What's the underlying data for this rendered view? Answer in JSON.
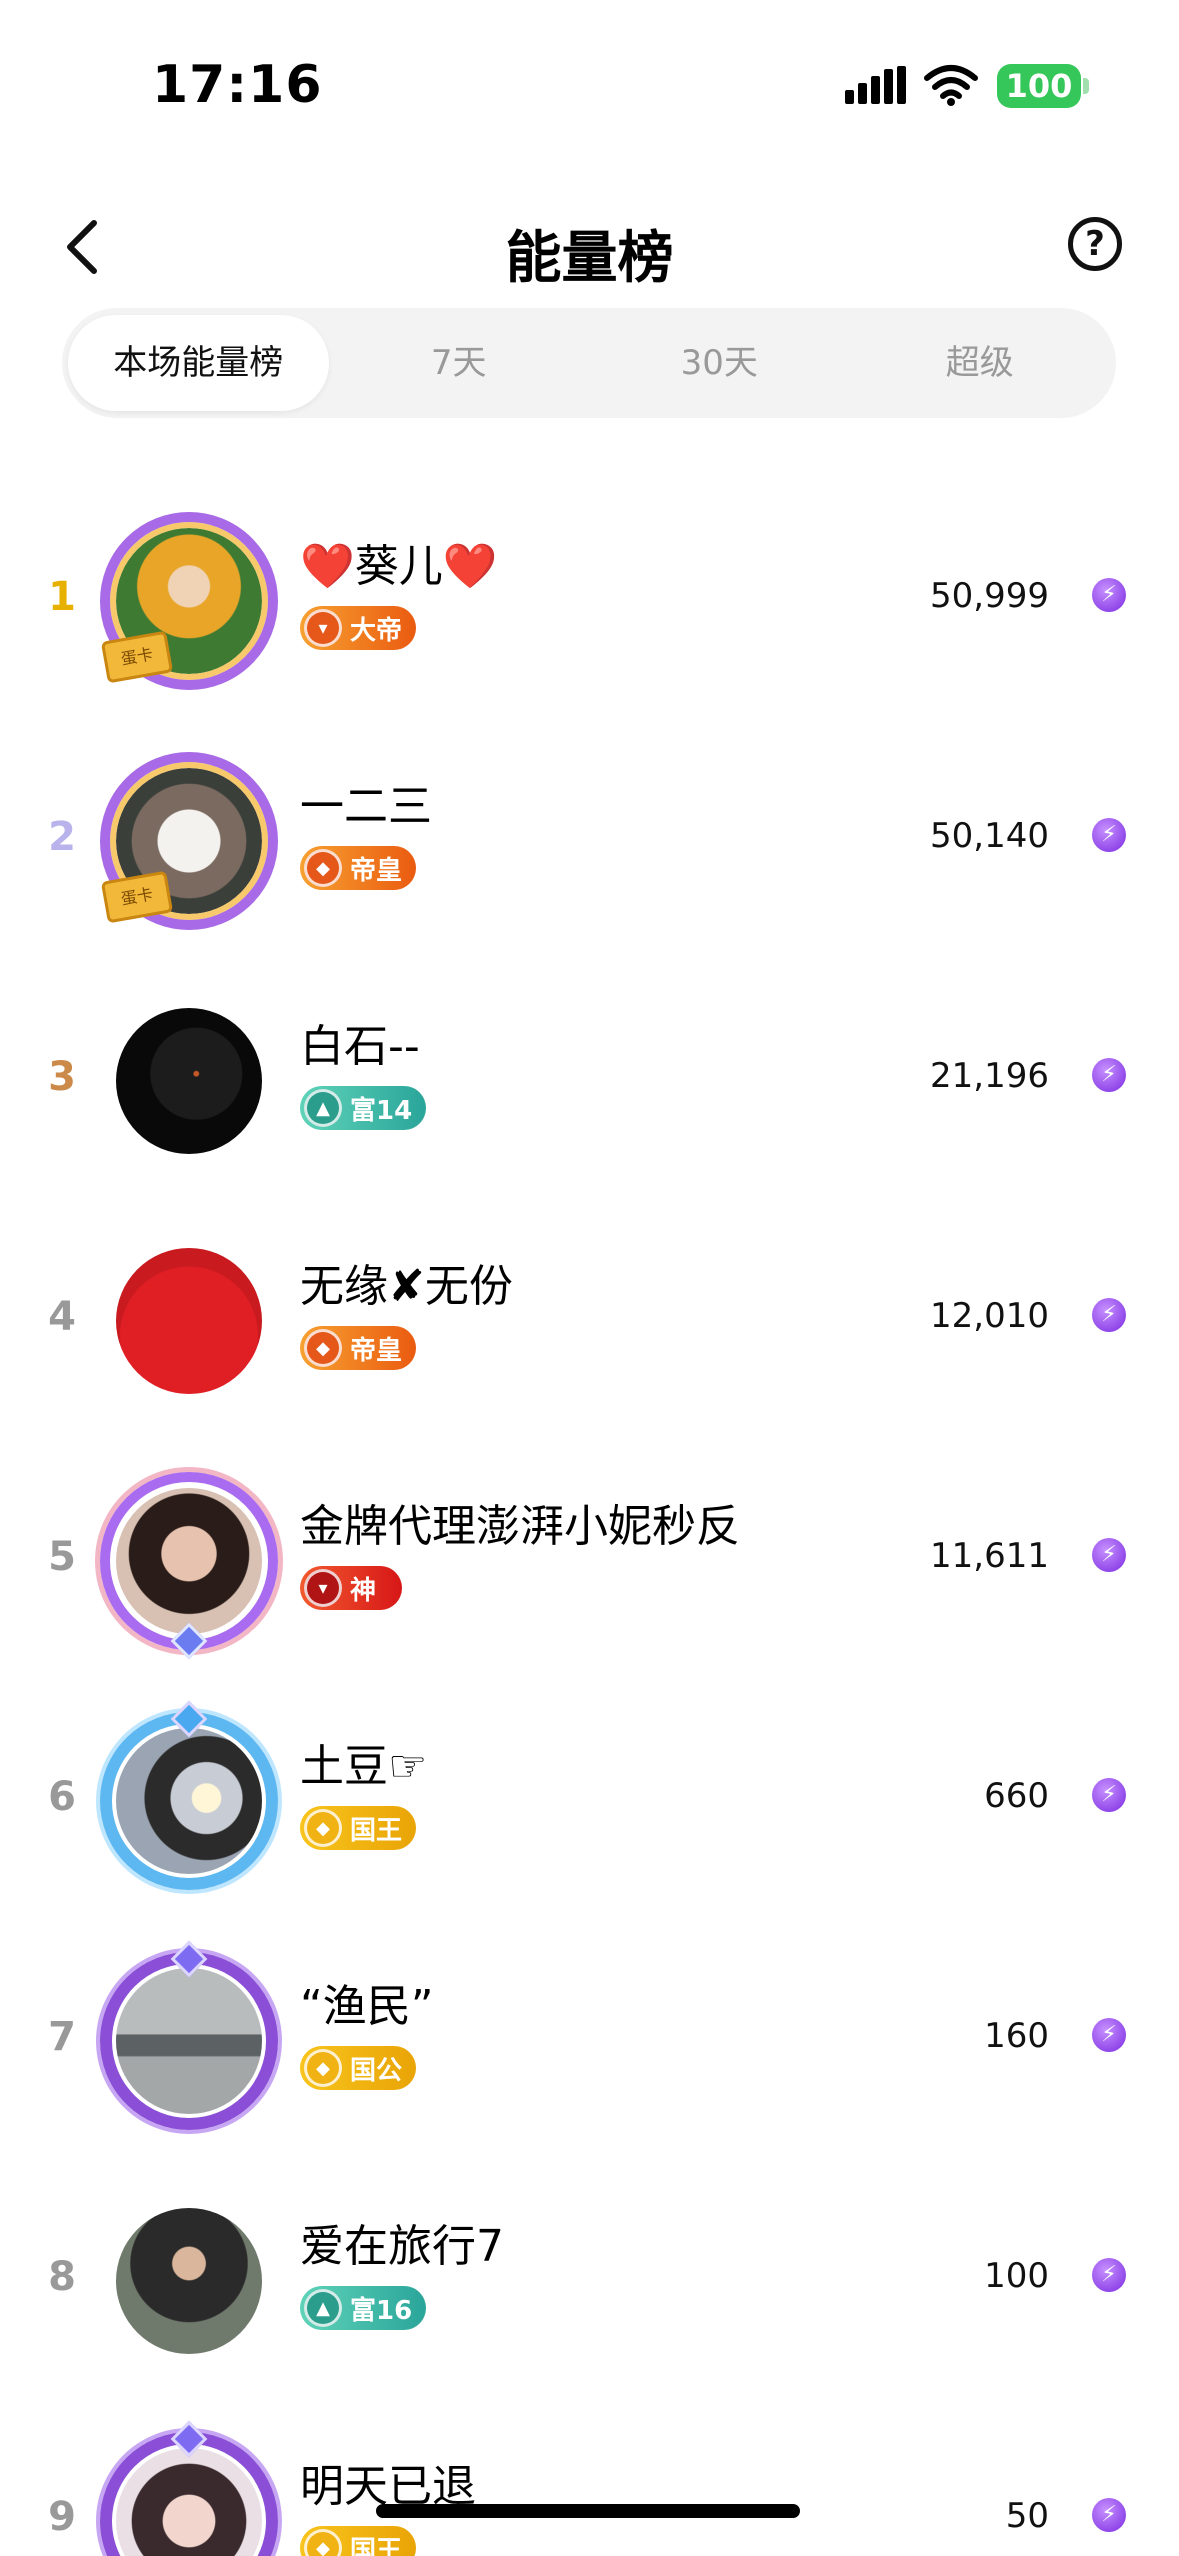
{
  "status_bar": {
    "time": "17:16",
    "battery": "100"
  },
  "nav": {
    "title": "能量榜",
    "help_glyph": "?"
  },
  "tabs": [
    {
      "label": "本场能量榜",
      "active": true
    },
    {
      "label": "7天",
      "active": false
    },
    {
      "label": "30天",
      "active": false
    },
    {
      "label": "超级",
      "active": false
    }
  ],
  "frame_card_label": "蛋卡",
  "energy_glyph": "⚡",
  "ranking": [
    {
      "rank": "1",
      "name": "❤️葵儿❤️",
      "badge": "大帝",
      "badge_style": "orange",
      "score": "50,999"
    },
    {
      "rank": "2",
      "name": "一二三",
      "badge": "帝皇",
      "badge_style": "orange",
      "score": "50,140"
    },
    {
      "rank": "3",
      "name": "白石--",
      "badge": "富14",
      "badge_style": "teal",
      "score": "21,196"
    },
    {
      "rank": "4",
      "name": "无缘✘无份",
      "badge": "帝皇",
      "badge_style": "orange",
      "score": "12,010"
    },
    {
      "rank": "5",
      "name": "金牌代理澎湃小妮秒反",
      "badge": "神",
      "badge_style": "red",
      "score": "11,611"
    },
    {
      "rank": "6",
      "name": "土豆☞",
      "badge": "国王",
      "badge_style": "gold",
      "score": "660"
    },
    {
      "rank": "7",
      "name": "“渔民”",
      "badge": "国公",
      "badge_style": "gold",
      "score": "160"
    },
    {
      "rank": "8",
      "name": "爱在旅行7",
      "badge": "富16",
      "badge_style": "teal",
      "score": "100"
    },
    {
      "rank": "9",
      "name": "明天已退",
      "badge": "国王",
      "badge_style": "gold",
      "score": "50"
    }
  ]
}
